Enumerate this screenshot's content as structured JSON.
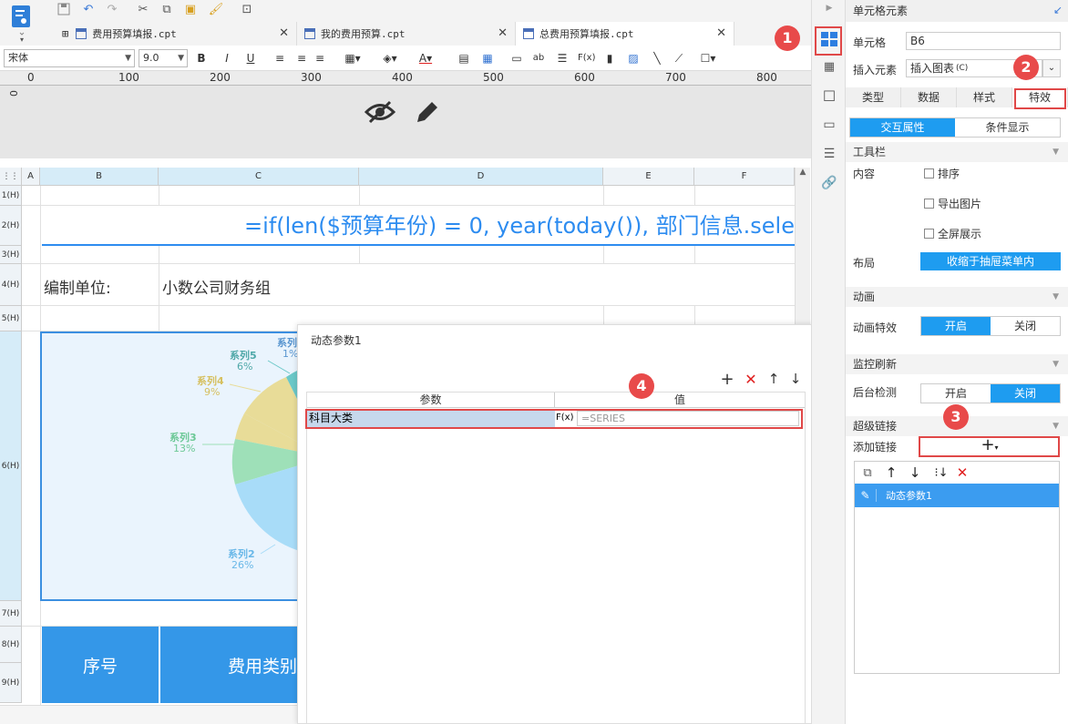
{
  "tabs": [
    {
      "label": "费用预算填报.cpt",
      "active": false
    },
    {
      "label": "我的费用预算.cpt",
      "active": false
    },
    {
      "label": "总费用预算填报.cpt",
      "active": true
    }
  ],
  "format_toolbar": {
    "font": "宋体",
    "size": "9.0"
  },
  "ruler": [
    "0",
    "100",
    "200",
    "300",
    "400",
    "500",
    "600",
    "700",
    "800"
  ],
  "vruler": "0",
  "columns": [
    "A",
    "B",
    "C",
    "D",
    "E",
    "F"
  ],
  "rows": [
    "1(H)",
    "2(H)",
    "3(H)",
    "4(H)",
    "5(H)",
    "6(H)",
    "7(H)",
    "8(H)",
    "9(H)"
  ],
  "sheet": {
    "formula": "=if(len($预算年份) = 0, year(today()), 部门信息.sele",
    "unit_label": "编制单位:",
    "unit_value": "小数公司财务组",
    "header_seq": "序号",
    "header_category": "费用类别"
  },
  "pie": {
    "slices": [
      {
        "name": "系列5",
        "pct": "6%",
        "color": "#6bc8c8"
      },
      {
        "name": "系列4",
        "pct": "9%",
        "color": "#e8dc98"
      },
      {
        "name": "系列3",
        "pct": "13%",
        "color": "#9ee0b8"
      },
      {
        "name": "系列2",
        "pct": "26%",
        "color": "#a8dcf8"
      },
      {
        "name": "系列",
        "pct": "1%",
        "color": "#7ab0e0"
      }
    ]
  },
  "dialog": {
    "title": "动态参数1",
    "col_param": "参数",
    "col_value": "值",
    "row_param": "科目大类",
    "row_value": "=SERIES",
    "fx": "F(x)"
  },
  "right_panel": {
    "title": "单元格元素",
    "cell_label": "单元格",
    "cell_value": "B6",
    "insert_label": "插入元素",
    "insert_value": "插入图表",
    "insert_shortcut": "(C)",
    "type_tabs": [
      "类型",
      "数据",
      "样式",
      "特效"
    ],
    "subtabs": [
      "交互属性",
      "条件显示"
    ],
    "toolbar_section": "工具栏",
    "content_label": "内容",
    "checks": [
      "排序",
      "导出图片",
      "全屏展示"
    ],
    "layout_label": "布局",
    "layout_value": "收缩于抽屉菜单内",
    "anim_section": "动画",
    "anim_label": "动画特效",
    "on": "开启",
    "off": "关闭",
    "monitor_section": "监控刷新",
    "monitor_label": "后台检测",
    "hyperlink_section": "超级链接",
    "add_link_label": "添加链接",
    "link_item": "动态参数1"
  },
  "badges": [
    "1",
    "2",
    "3",
    "4"
  ]
}
